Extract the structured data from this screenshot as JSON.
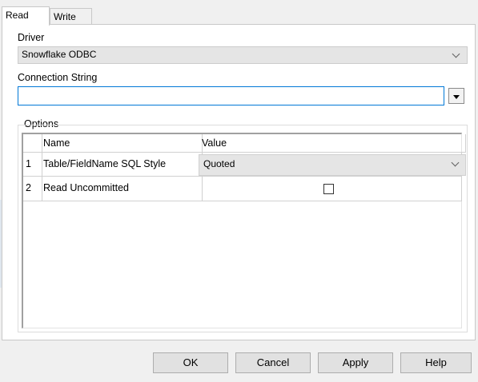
{
  "tabs": [
    {
      "label": "Read",
      "active": true
    },
    {
      "label": "Write",
      "active": false
    }
  ],
  "driver": {
    "label": "Driver",
    "value": "Snowflake ODBC"
  },
  "connection": {
    "label": "Connection String",
    "value": ""
  },
  "options": {
    "label": "Options",
    "columns": [
      "Name",
      "Value"
    ],
    "rows": [
      {
        "num": "1",
        "name": "Table/FieldName SQL Style",
        "value": "Quoted",
        "type": "select"
      },
      {
        "num": "2",
        "name": "Read Uncommitted",
        "value": false,
        "type": "checkbox"
      }
    ]
  },
  "buttons": {
    "ok": "OK",
    "cancel": "Cancel",
    "apply": "Apply",
    "help": "Help"
  }
}
